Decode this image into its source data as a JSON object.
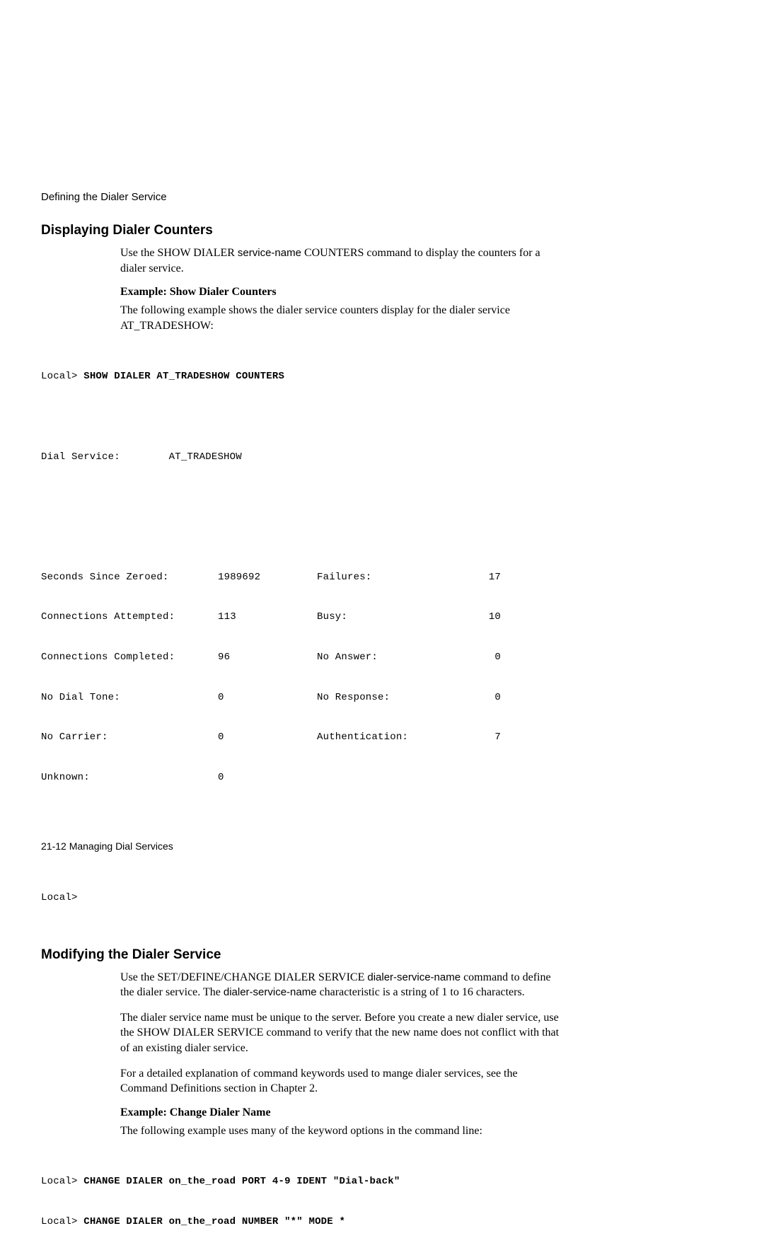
{
  "header": {
    "title": "Defining the Dialer Service"
  },
  "section1": {
    "heading": "Displaying Dialer Counters",
    "para1_a": "Use the SHOW DIALER ",
    "para1_b": "service-name",
    "para1_c": " COUNTERS command to display the counters for a dialer service.",
    "example_heading": "Example: Show Dialer Counters",
    "para2": "The following example shows the dialer service counters display for the dialer service AT_TRADESHOW:",
    "code_prompt1": "Local> ",
    "code_cmd1": "SHOW DIALER AT_TRADESHOW COUNTERS",
    "dial_service_label": "Dial Service:        AT_TRADESHOW",
    "counters": [
      {
        "l1": "Seconds Since Zeroed:",
        "v1": "1989692",
        "l2": "Failures:",
        "v2": "17"
      },
      {
        "l1": "Connections Attempted:",
        "v1": "113",
        "l2": "Busy:",
        "v2": "10"
      },
      {
        "l1": "Connections Completed:",
        "v1": "96",
        "l2": "No Answer:",
        "v2": "0"
      },
      {
        "l1": "No Dial Tone:",
        "v1": "0",
        "l2": "No Response:",
        "v2": "0"
      },
      {
        "l1": "No Carrier:",
        "v1": "0",
        "l2": "Authentication:",
        "v2": "7"
      },
      {
        "l1": "Unknown:",
        "v1": "0",
        "l2": "",
        "v2": ""
      }
    ],
    "code_prompt_end": "Local>"
  },
  "section2": {
    "heading": "Modifying the Dialer Service",
    "para1_a": "Use the SET/DEFINE/CHANGE DIALER SERVICE ",
    "para1_b": "dialer-service-name",
    "para1_c": " command to define the dialer service. The ",
    "para1_d": "dialer-service-name",
    "para1_e": " characteristic is a string of 1 to 16 characters.",
    "para2": "The dialer service name must be unique to the server. Before you create a new dialer service, use the SHOW DIALER SERVICE command to verify that the new name does not conflict with that of an existing dialer service.",
    "para3": "For a detailed explanation of command keywords used to mange dialer services, see the Command Definitions section in Chapter 2.",
    "example_heading": "Example: Change Dialer Name",
    "para4": "The following example uses many of the keyword options in the command line:",
    "code_prompt1": "Local> ",
    "code_cmd1": "CHANGE DIALER on_the_road PORT 4-9 IDENT \"Dial-back\"",
    "code_prompt2": "Local> ",
    "code_cmd2": "CHANGE DIALER on_the_road NUMBER \"*\" MODE *"
  },
  "footer": {
    "text": "21-12  Managing Dial Services"
  }
}
